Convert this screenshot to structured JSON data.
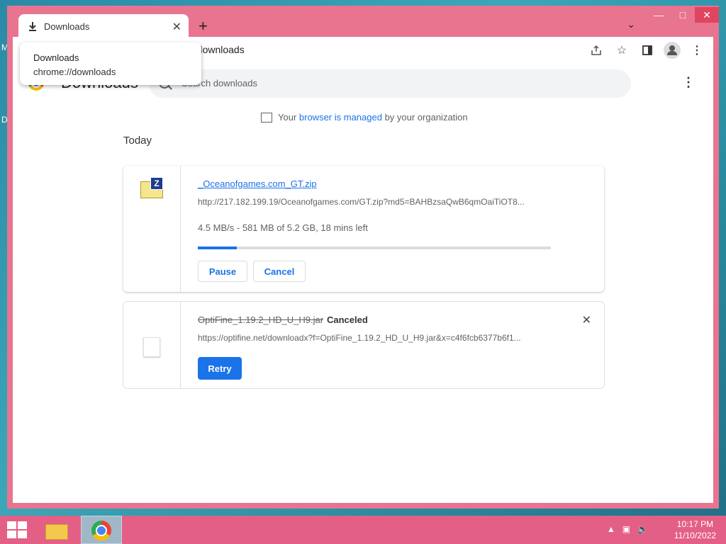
{
  "tab": {
    "title": "Downloads"
  },
  "tooltip": {
    "title": "Downloads",
    "url": "chrome://downloads"
  },
  "omnibox": {
    "url": "//downloads"
  },
  "page": {
    "title": "Downloads",
    "search_placeholder": "Search downloads",
    "managed": {
      "prefix": "Your ",
      "link": "browser is managed",
      "suffix": " by your organization"
    },
    "section_label": "Today"
  },
  "downloads": [
    {
      "filename": "_Oceanofgames.com_GT.zip",
      "url": "http://217.182.199.19/Oceanofgames.com/GT.zip?md5=BAHBzsaQwB6qmOaiTiOT8...",
      "status": "4.5 MB/s - 581 MB of 5.2 GB, 18 mins left",
      "progress": 0.11,
      "pause_label": "Pause",
      "cancel_label": "Cancel"
    },
    {
      "filename": "OptiFine_1.19.2_HD_U_H9.jar",
      "state": "Canceled",
      "url": "https://optifine.net/downloadx?f=OptiFine_1.19.2_HD_U_H9.jar&x=c4f6fcb6377b6f1...",
      "retry_label": "Retry"
    }
  ],
  "taskbar": {
    "time": "10:17 PM",
    "date": "11/10/2022"
  },
  "colors": {
    "accent": "#1a73e8",
    "window_frame": "#e8748f",
    "taskbar": "#e45f86"
  }
}
